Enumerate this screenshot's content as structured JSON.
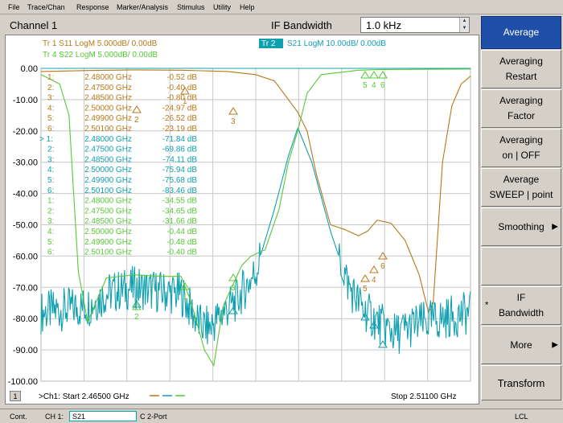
{
  "menubar": {
    "items": [
      "File",
      "Trace/Chan",
      "Response",
      "Marker/Analysis",
      "Stimulus",
      "Utility",
      "Help"
    ]
  },
  "header": {
    "channel_title": "Channel 1",
    "ifbw_label": "IF Bandwidth",
    "ifbw_value": "1.0 kHz"
  },
  "softkeys": [
    {
      "label": "Average",
      "active": true,
      "arrow": false,
      "star": false
    },
    {
      "label": "Averaging\nRestart",
      "active": false,
      "arrow": false,
      "star": false
    },
    {
      "label": "Averaging\nFactor",
      "active": false,
      "arrow": false,
      "star": false
    },
    {
      "label": "Averaging\non | OFF",
      "active": false,
      "arrow": false,
      "star": false
    },
    {
      "label": "Average\nSWEEP | point",
      "active": false,
      "arrow": false,
      "star": false
    },
    {
      "label": "Smoothing",
      "active": false,
      "arrow": true,
      "star": false
    },
    {
      "label": "",
      "active": false,
      "arrow": false,
      "star": false
    },
    {
      "label": "IF\nBandwidth",
      "active": false,
      "arrow": false,
      "star": true
    },
    {
      "label": "More",
      "active": false,
      "arrow": true,
      "star": false
    },
    {
      "label": "Transform",
      "active": false,
      "arrow": false,
      "star": false
    }
  ],
  "softkey_marks": {
    "arrow": "▶",
    "star": "*"
  },
  "traces": {
    "tr1": "Tr  1   S11 LogM 5.000dB/  0.00dB",
    "tr4": "Tr  4   S22 LogM 5.000dB/  0.00dB",
    "tr2_tag": "Tr  2",
    "tr2": "S21 LogM 10.00dB/  0.00dB"
  },
  "markers": {
    "tr1": [
      {
        "n": "1:",
        "f": "2.48000 GHz",
        "v": "-0.52 dB"
      },
      {
        "n": "2:",
        "f": "2.47500 GHz",
        "v": "-0.40 dB"
      },
      {
        "n": "3:",
        "f": "2.48500 GHz",
        "v": "-0.80 dB"
      },
      {
        "n": "4:",
        "f": "2.50000 GHz",
        "v": "-24.97 dB"
      },
      {
        "n": "5:",
        "f": "2.49900 GHz",
        "v": "-26.52 dB"
      },
      {
        "n": "6:",
        "f": "2.50100 GHz",
        "v": "-23.19 dB"
      }
    ],
    "tr2": [
      {
        "n": "> 1:",
        "f": "2.48000 GHz",
        "v": "-71.84 dB"
      },
      {
        "n": "2:",
        "f": "2.47500 GHz",
        "v": "-69.86 dB"
      },
      {
        "n": "3:",
        "f": "2.48500 GHz",
        "v": "-74.11 dB"
      },
      {
        "n": "4:",
        "f": "2.50000 GHz",
        "v": "-75.94 dB"
      },
      {
        "n": "5:",
        "f": "2.49900 GHz",
        "v": "-75.68 dB"
      },
      {
        "n": "6:",
        "f": "2.50100 GHz",
        "v": "-83.46 dB"
      }
    ],
    "tr4": [
      {
        "n": "1:",
        "f": "2.48000 GHz",
        "v": "-34.55 dB"
      },
      {
        "n": "2:",
        "f": "2.47500 GHz",
        "v": "-34.65 dB"
      },
      {
        "n": "3:",
        "f": "2.48500 GHz",
        "v": "-31.66 dB"
      },
      {
        "n": "4:",
        "f": "2.50000 GHz",
        "v": "-0.44 dB"
      },
      {
        "n": "5:",
        "f": "2.49900 GHz",
        "v": "-0.48 dB"
      },
      {
        "n": "6:",
        "f": "2.50100 GHz",
        "v": "-0.40 dB"
      }
    ]
  },
  "plot_bottom": {
    "channel_num": "1",
    "start": ">Ch1: Start  2.46500 GHz",
    "stop": "Stop  2.51100 GHz"
  },
  "statusbar": {
    "mode": "Cont.",
    "ch": "CH 1:",
    "trace": "S21",
    "c_port": "C  2-Port",
    "lcl": "LCL"
  },
  "colors": {
    "s11": "#b87818",
    "s21": "#10a0b0",
    "s22": "#58c838",
    "active": "#1f4fa8"
  },
  "chart_data": {
    "type": "line",
    "xlabel": "",
    "ylabel": "",
    "ylim": [
      -100,
      0
    ],
    "yticks": [
      "0.00",
      "-10.00",
      "-20.00",
      "-30.00",
      "-40.00",
      "-50.00",
      "-60.00",
      "-70.00",
      "-80.00",
      "-90.00",
      "-100.00"
    ],
    "x_start_ghz": 2.465,
    "x_stop_ghz": 2.511,
    "grid": true,
    "series": [
      {
        "name": "S11",
        "x": [
          2.465,
          2.47,
          2.475,
          2.48,
          2.485,
          2.488,
          2.49,
          2.491,
          2.4925,
          2.4935,
          2.4945,
          2.496,
          2.4975,
          2.499,
          2.5,
          2.501,
          2.5025,
          2.504,
          2.5055,
          2.5065,
          2.507,
          2.508,
          2.509,
          2.51,
          2.511
        ],
        "y": [
          -1.0,
          -0.7,
          -0.5,
          -0.6,
          -1.0,
          -2.0,
          -4.0,
          -8.0,
          -14.0,
          -20.0,
          -34.0,
          -50.0,
          -51.5,
          -53.5,
          -52.0,
          -48.5,
          -49.5,
          -55.0,
          -66.0,
          -78.0,
          -75.0,
          -30.0,
          -12.0,
          -5.0,
          -2.5
        ]
      },
      {
        "name": "S21",
        "x": [
          2.465,
          2.47,
          2.472,
          2.475,
          2.478,
          2.48,
          2.482,
          2.483,
          2.4845,
          2.486,
          2.488,
          2.49,
          2.4915,
          2.4925,
          2.494,
          2.496,
          2.498,
          2.4995,
          2.501,
          2.503,
          2.505,
          2.508,
          2.511
        ],
        "y": [
          -78.0,
          -76.0,
          -72.0,
          -70.0,
          -71.5,
          -72.0,
          -82.0,
          -83.0,
          -78.0,
          -74.0,
          -65.0,
          -45.0,
          -28.0,
          -19.0,
          -30.0,
          -52.0,
          -70.0,
          -77.0,
          -81.0,
          -85.0,
          -82.0,
          -80.0,
          -78.0
        ]
      },
      {
        "name": "S22",
        "x": [
          2.465,
          2.467,
          2.468,
          2.4685,
          2.469,
          2.47,
          2.472,
          2.475,
          2.478,
          2.48,
          2.481,
          2.4825,
          2.4835,
          2.4845,
          2.4865,
          2.4875,
          2.489,
          2.4905,
          2.4915,
          2.4925,
          2.4935,
          2.495,
          2.499,
          2.5,
          2.501,
          2.505,
          2.511
        ],
        "y": [
          -2.0,
          -5.0,
          -15.0,
          -40.0,
          -65.0,
          -81.0,
          -67.0,
          -66.0,
          -66.5,
          -66.5,
          -74.0,
          -90.0,
          -95.0,
          -76.0,
          -63.0,
          -60.0,
          -58.0,
          -45.0,
          -30.0,
          -20.0,
          -8.0,
          -2.0,
          -0.6,
          -0.5,
          -0.4,
          -0.3,
          -0.2
        ]
      }
    ]
  }
}
